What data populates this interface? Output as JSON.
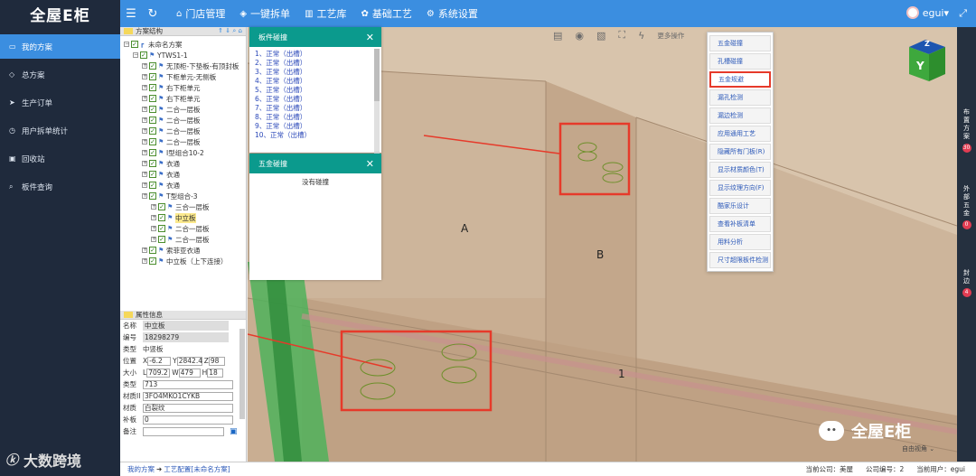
{
  "header": {
    "logo": "全屋E柜",
    "nav": [
      {
        "label": "门店管理",
        "icon": "house-icon"
      },
      {
        "label": "一键拆单",
        "icon": "shield-icon"
      },
      {
        "label": "工艺库",
        "icon": "bars-icon"
      },
      {
        "label": "基础工艺",
        "icon": "palette-icon"
      },
      {
        "label": "系统设置",
        "icon": "gear-icon"
      }
    ],
    "user": "egui"
  },
  "sidebar": {
    "items": [
      {
        "label": "我的方案",
        "active": true
      },
      {
        "label": "总方案"
      },
      {
        "label": "生产订单"
      },
      {
        "label": "用户拆单统计"
      },
      {
        "label": "回收站"
      },
      {
        "label": "板件查询"
      }
    ],
    "watermark": "大数跨境"
  },
  "tree_panel": {
    "title": "方案结构",
    "rows": [
      {
        "text": "未命名方案",
        "level": 0
      },
      {
        "text": "YTWS1-1",
        "level": 1
      },
      {
        "text": "无顶柜-下垫板-有顶封板",
        "level": 2
      },
      {
        "text": "下柜单元-无侧板",
        "level": 2
      },
      {
        "text": "右下柜单元",
        "level": 2
      },
      {
        "text": "右下柜单元",
        "level": 2
      },
      {
        "text": "二合一层板",
        "level": 2
      },
      {
        "text": "二合一层板",
        "level": 2
      },
      {
        "text": "二合一层板",
        "level": 2
      },
      {
        "text": "二合一层板",
        "level": 2
      },
      {
        "text": "I型组合10-2",
        "level": 2
      },
      {
        "text": "衣通",
        "level": 2
      },
      {
        "text": "衣通",
        "level": 2
      },
      {
        "text": "衣通",
        "level": 2
      },
      {
        "text": "T型组合-3",
        "level": 2
      },
      {
        "text": "三合一层板",
        "level": 3
      },
      {
        "text": "中立板",
        "level": 3,
        "selected": true
      },
      {
        "text": "二合一层板",
        "level": 3
      },
      {
        "text": "二合一层板",
        "level": 3
      },
      {
        "text": "索菲亚衣通",
        "level": 2
      },
      {
        "text": "中立板（上下连接）",
        "level": 2
      }
    ]
  },
  "prop_panel": {
    "title": "属性信息",
    "name_label": "名称",
    "name_value": "中立板",
    "code_label": "编号",
    "code_value": "18298279",
    "type_label": "类型",
    "type_value": "中竖板",
    "pos_label": "位置",
    "pos_x": "-6.2",
    "pos_y": "2842.4",
    "pos_z": "98",
    "size_label": "大小",
    "size_l": "709.2",
    "size_w": "479",
    "size_h": "18",
    "kind_label": "类型",
    "kind_value": "713",
    "mat1_label": "材质II",
    "mat1_value": "3FO4MKO1CYKB",
    "mat_label": "材质",
    "mat_value": "白裂纹",
    "patch_label": "补板",
    "patch_value": "0",
    "note_label": "备注",
    "note_value": ""
  },
  "dialog_board": {
    "title": "板件碰撞",
    "items": [
      "1、正常（出槽）",
      "2、正常（出槽）",
      "3、正常（出槽）",
      "4、正常（出槽）",
      "5、正常（出槽）",
      "6、正常（出槽）",
      "7、正常（出槽）",
      "8、正常（出槽）",
      "9、正常（出槽）",
      "10、正常（出槽）"
    ]
  },
  "dialog_hardware": {
    "title": "五金碰撞",
    "message": "没有碰撞"
  },
  "toolbar3d": {
    "more": "更多操作"
  },
  "menu": {
    "items": [
      "五金碰撞",
      "孔槽碰撞",
      "五金规避",
      "漏孔检测",
      "漏边检测",
      "应用通用工艺",
      "隐藏所有门板(R)",
      "显示材质颜色(T)",
      "显示纹理方向(F)",
      "酷家乐设计",
      "查看补板清单",
      "用料分析",
      "尺寸超限板件检测"
    ],
    "highlighted_index": 2
  },
  "viewport": {
    "label_a": "A",
    "label_b": "B",
    "label_1": "1",
    "viewcube_front": "Y",
    "viewcube_top": "Z",
    "view_mode": "自由视角",
    "watermark": "全屋E柜"
  },
  "rightrail": [
    {
      "label": "布置方案",
      "count": "30"
    },
    {
      "label": "外部五金",
      "count": "0"
    },
    {
      "label": "封边",
      "count": "4"
    }
  ],
  "footer": {
    "crumb_home": "我的方案",
    "crumb_arrow": "➜",
    "crumb_current": "工艺配置[未命名方案]",
    "company_label": "当前公司：美屋",
    "company_code": "公司编号：2",
    "current_user": "当前用户：egui"
  },
  "colors": {
    "header": "#3b8ee0",
    "sidebar": "#1f2a3c",
    "dialog_head": "#0b9a8d",
    "highlight": "#e63a2a"
  }
}
